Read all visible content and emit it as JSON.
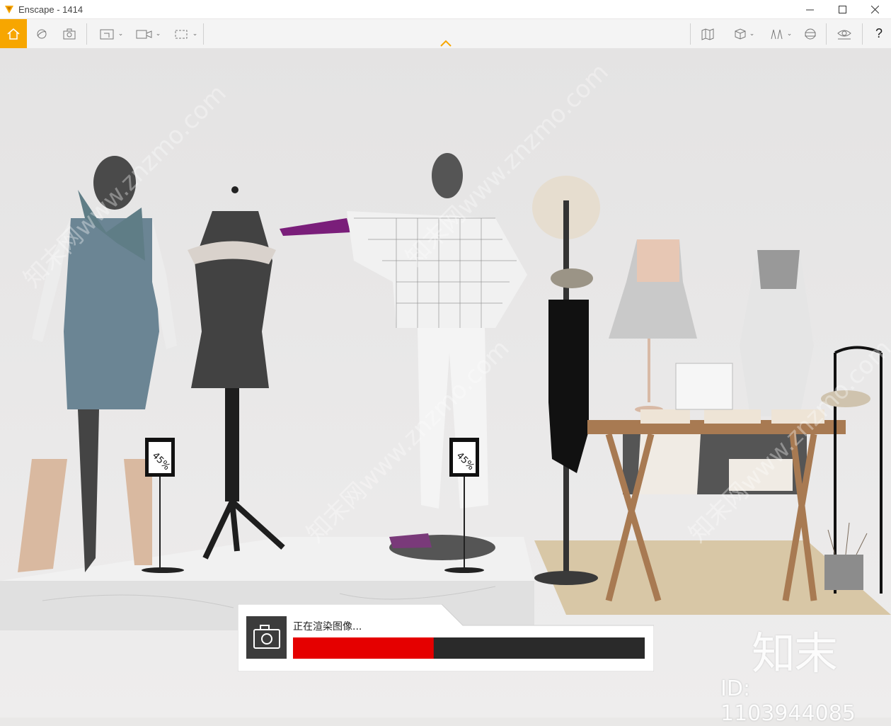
{
  "window": {
    "title": "Enscape - 1414"
  },
  "toolbar": {
    "left": [
      "home-icon",
      "orbit-icon",
      "screenshot-icon",
      "render-icon",
      "video-icon",
      "panorama-icon"
    ],
    "right": [
      "map-icon",
      "view-cube-icon",
      "asset-library-icon",
      "vr-headset-icon",
      "visual-settings-icon"
    ],
    "help_label": "?"
  },
  "render_status": {
    "text": "正在渲染图像...",
    "progress": 0.4
  },
  "watermark": {
    "logo": "知末",
    "id": "ID: 1103944085",
    "diagonal": "知末网www.znzmo.com"
  },
  "colors": {
    "accent": "#f7a600",
    "progress": "#e50000",
    "track": "#2a2a2a"
  }
}
